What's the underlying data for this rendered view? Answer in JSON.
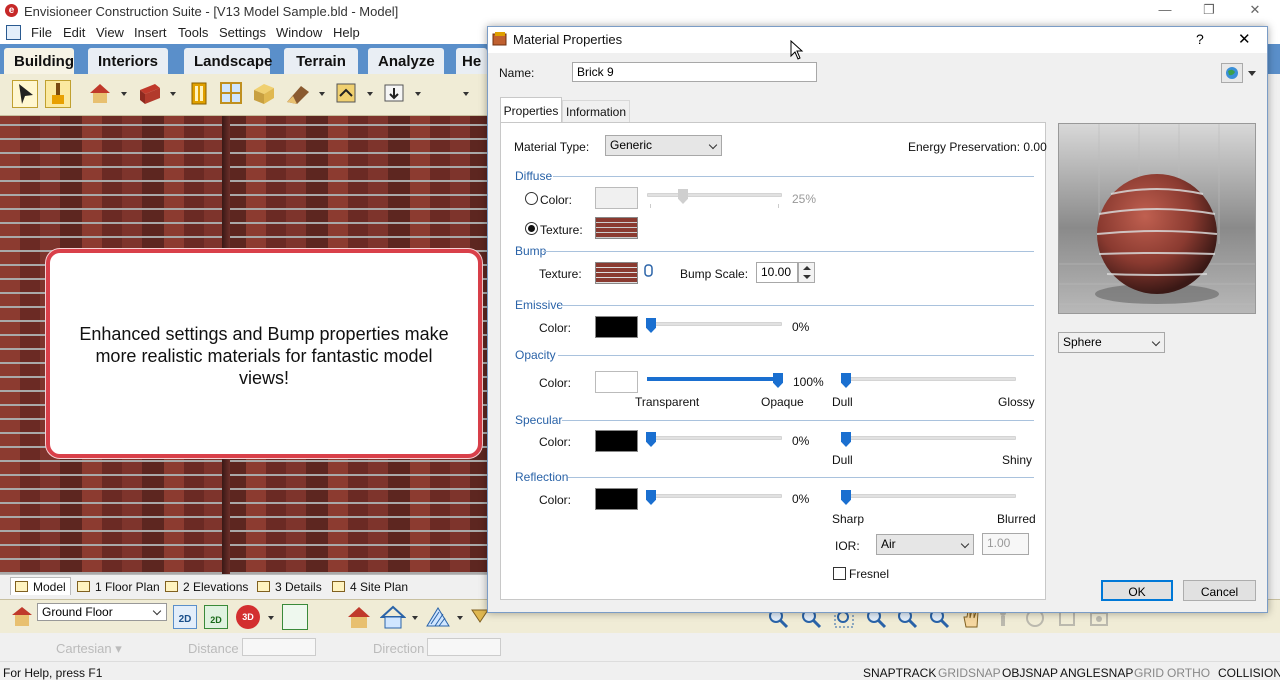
{
  "app": {
    "title": "Envisioneer Construction Suite - [V13 Model Sample.bld - Model]",
    "menu": [
      "File",
      "Edit",
      "View",
      "Insert",
      "Tools",
      "Settings",
      "Window",
      "Help"
    ],
    "ribbon_tabs": [
      "Building",
      "Interiors",
      "Landscape",
      "Terrain",
      "Analyze",
      "He"
    ],
    "view_tabs": [
      "Model",
      "1 Floor Plan",
      "2 Elevations",
      "3 Details",
      "4 Site Plan"
    ],
    "floor_select": "Ground Floor",
    "coord": {
      "mode": "Cartesian",
      "distance_label": "Distance",
      "direction_label": "Direction"
    },
    "status": {
      "help": "For Help, press F1",
      "toggles": [
        "SNAPTRACK",
        "GRIDSNAP",
        "OBJSNAP",
        "ANGLESNAP",
        "GRID",
        "ORTHO",
        "COLLISION"
      ]
    },
    "callout": "Enhanced settings and Bump properties make more realistic materials for fantastic model views!",
    "colors": {
      "ribbon": "#5a8fca",
      "callout_border": "#d9404a",
      "accent": "#1a6fd0"
    }
  },
  "dialog": {
    "title": "Material Properties",
    "help_label": "?",
    "close_label": "✕",
    "name_label": "Name:",
    "name_value": "Brick 9",
    "tabs": [
      "Properties",
      "Information"
    ],
    "material_type_label": "Material Type:",
    "material_type_value": "Generic",
    "energy_preservation": "Energy Preservation: 0.00",
    "diffuse": {
      "section": "Diffuse",
      "color_label": "Color:",
      "texture_label": "Texture:",
      "selected": "Texture",
      "percent": "25%",
      "value": 0.25
    },
    "bump": {
      "section": "Bump",
      "texture_label": "Texture:",
      "scale_label": "Bump Scale:",
      "scale_value": "10.00"
    },
    "emissive": {
      "section": "Emissive",
      "color_label": "Color:",
      "percent": "0%",
      "value": 0
    },
    "opacity": {
      "section": "Opacity",
      "color_label": "Color:",
      "percent": "100%",
      "value": 1.0,
      "left_label": "Transparent",
      "right_label": "Opaque",
      "gloss_left": "Dull",
      "gloss_right": "Glossy"
    },
    "specular": {
      "section": "Specular",
      "color_label": "Color:",
      "percent": "0%",
      "value": 0,
      "left": "Dull",
      "right": "Shiny"
    },
    "reflection": {
      "section": "Reflection",
      "color_label": "Color:",
      "percent": "0%",
      "value": 0,
      "left": "Sharp",
      "right": "Blurred",
      "ior_label": "IOR:",
      "ior_value": "Air",
      "ior_number": "1.00",
      "fresnel_label": "Fresnel",
      "fresnel_checked": false
    },
    "preview_shape": "Sphere",
    "ok_label": "OK",
    "cancel_label": "Cancel"
  }
}
